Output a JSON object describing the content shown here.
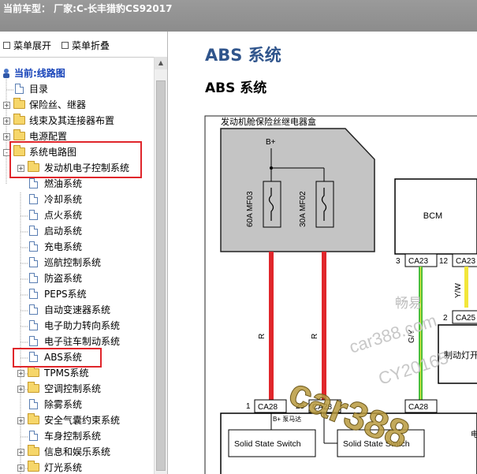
{
  "window": {
    "title": "当前车型：  厂家:C-长丰猎豹CS92017"
  },
  "toolbar": {
    "expand_label": "菜单展开",
    "collapse_label": "菜单折叠"
  },
  "tree": {
    "current_label": "当前:线路图",
    "items": [
      {
        "label": "目录"
      },
      {
        "label": "保险丝、继器"
      },
      {
        "label": "线束及其连接器布置"
      },
      {
        "label": "电源配置"
      },
      {
        "label": "系统电路图"
      },
      {
        "label": "发动机电子控制系统"
      },
      {
        "label": "燃油系统"
      },
      {
        "label": "冷却系统"
      },
      {
        "label": "点火系统"
      },
      {
        "label": "启动系统"
      },
      {
        "label": "充电系统"
      },
      {
        "label": "巡航控制系统"
      },
      {
        "label": "防盗系统"
      },
      {
        "label": "PEPS系统"
      },
      {
        "label": "自动变速器系统"
      },
      {
        "label": "电子助力转向系统"
      },
      {
        "label": "电子驻车制动系统"
      },
      {
        "label": "ABS系统"
      },
      {
        "label": "TPMS系统"
      },
      {
        "label": "空调控制系统"
      },
      {
        "label": "除雾系统"
      },
      {
        "label": "安全气囊约束系统"
      },
      {
        "label": "车身控制系统"
      },
      {
        "label": "信息和娱乐系统"
      },
      {
        "label": "灯光系统"
      }
    ]
  },
  "content": {
    "heading_blue": "ABS 系统",
    "heading_black": "ABS 系统",
    "diagram": {
      "fuse_box_title": "发动机舱保险丝继电器盒",
      "bplus": "B+",
      "fuse1": "60A  MF03",
      "fuse2": "30A  MF02",
      "bcm": "BCM",
      "wire_r1": "R",
      "wire_r2": "R",
      "wire_gy": "G/Y",
      "wire_yw": "Y/W",
      "pin3": "3",
      "ca23_a": "CA23",
      "pin12": "12",
      "ca23_b": "CA23",
      "pin2": "2",
      "ca25": "CA25",
      "brake_switch": "制动灯开",
      "pin1": "1",
      "ca28_a": "CA28",
      "pin25": "25",
      "ca28_b": "CA28",
      "ca28_c": "CA28",
      "pump_label": "B+ 泵马达",
      "sss1": "Solid State Switch",
      "sss2": "Solid State Switch",
      "edge_label": "电"
    },
    "watermarks": {
      "w1": "畅易",
      "w2": "car388.com",
      "w3": "CY20165",
      "w4": "car388"
    }
  }
}
